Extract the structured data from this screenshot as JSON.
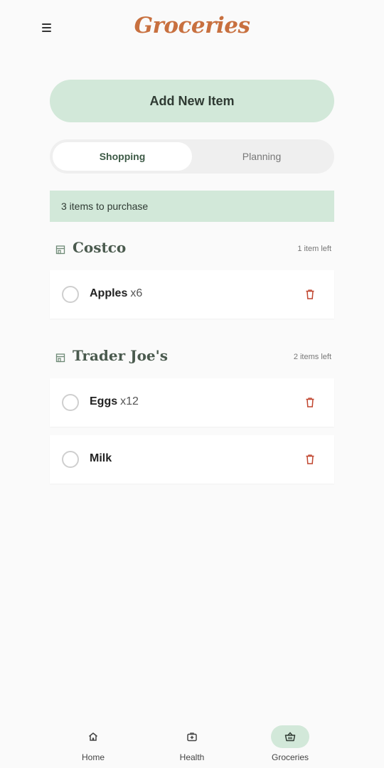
{
  "header": {
    "menu_icon": "hamburger-menu-icon",
    "brand_title": "Groceries",
    "brand_color": "#c8703f"
  },
  "actions": {
    "add_item_label": "Add New Item"
  },
  "tabs": [
    {
      "label": "Shopping",
      "active": true
    },
    {
      "label": "Planning",
      "active": false
    }
  ],
  "summary": {
    "text": "3 items to purchase"
  },
  "stores": [
    {
      "name": "Costco",
      "count_text": "1 item left",
      "icon": "store-icon",
      "items": [
        {
          "name": "Apples",
          "qty": "x6",
          "checked": false
        }
      ]
    },
    {
      "name": "Trader Joe's",
      "count_text": "2 items left",
      "icon": "store-icon",
      "items": [
        {
          "name": "Eggs",
          "qty": "x12",
          "checked": false
        },
        {
          "name": "Milk",
          "qty": "",
          "checked": false
        }
      ]
    }
  ],
  "bottom_nav": [
    {
      "label": "Home",
      "icon": "home-icon",
      "active": false
    },
    {
      "label": "Health",
      "icon": "medical-kit-icon",
      "active": false
    },
    {
      "label": "Groceries",
      "icon": "basket-icon",
      "active": true
    }
  ],
  "colors": {
    "accent_light": "#d2e8d9",
    "accent_dark": "#3d5a46",
    "danger": "#c0452e",
    "background": "#fafafa"
  }
}
